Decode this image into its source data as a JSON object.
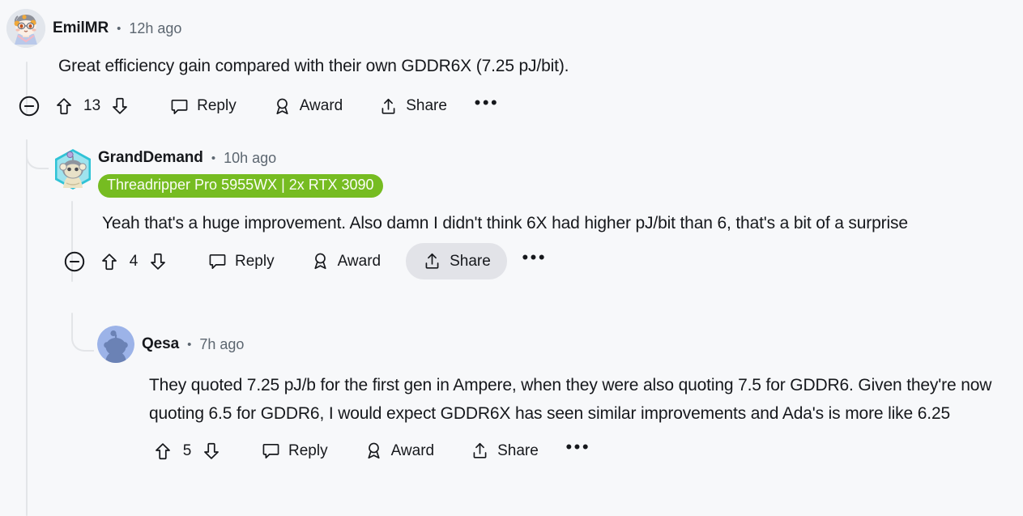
{
  "theme": {
    "background": "#f7f8fa",
    "text": "#16181c",
    "meta_text": "#5c6670",
    "thread_line": "#e3e5e8",
    "flair_bg": "#76bc21",
    "flair_text": "#fbfdf6",
    "hover_bg": "#e2e3e8"
  },
  "comments": [
    {
      "id": "comment-emilmr",
      "username": "EmilMR",
      "separator": "•",
      "timestamp": "12h ago",
      "avatar": "anime-character-avatar",
      "flair": null,
      "body": "Great efficiency gain compared with their own GDDR6X (7.25 pJ/bit).",
      "actions": {
        "collapse_label": "collapse-thread",
        "score": "13",
        "upvote_label": "upvote",
        "downvote_label": "downvote",
        "reply_label": "Reply",
        "award_label": "Award",
        "share_label": "Share",
        "more_label": "•••",
        "share_hovered": false,
        "has_collapse": true
      }
    },
    {
      "id": "comment-granddemand",
      "username": "GrandDemand",
      "separator": "•",
      "timestamp": "10h ago",
      "avatar": "snoo-hexagon-nft-avatar",
      "flair": "Threadripper Pro 5955WX | 2x RTX 3090",
      "body": "Yeah that's a huge improvement. Also damn I didn't think 6X had higher pJ/bit than 6, that's a bit of a surprise",
      "actions": {
        "collapse_label": "collapse-thread",
        "score": "4",
        "upvote_label": "upvote",
        "downvote_label": "downvote",
        "reply_label": "Reply",
        "award_label": "Award",
        "share_label": "Share",
        "more_label": "•••",
        "share_hovered": true,
        "has_collapse": true
      }
    },
    {
      "id": "comment-qesa",
      "username": "Qesa",
      "separator": "•",
      "timestamp": "7h ago",
      "avatar": "snoo-default-avatar",
      "flair": null,
      "body": "They quoted 7.25 pJ/b for the first gen in Ampere, when they were also quoting 7.5 for GDDR6. Given they're now quoting 6.5 for GDDR6, I would expect GDDR6X has seen similar improvements and Ada's is more like 6.25",
      "actions": {
        "score": "5",
        "upvote_label": "upvote",
        "downvote_label": "downvote",
        "reply_label": "Reply",
        "award_label": "Award",
        "share_label": "Share",
        "more_label": "•••",
        "share_hovered": false,
        "has_collapse": false
      }
    }
  ]
}
